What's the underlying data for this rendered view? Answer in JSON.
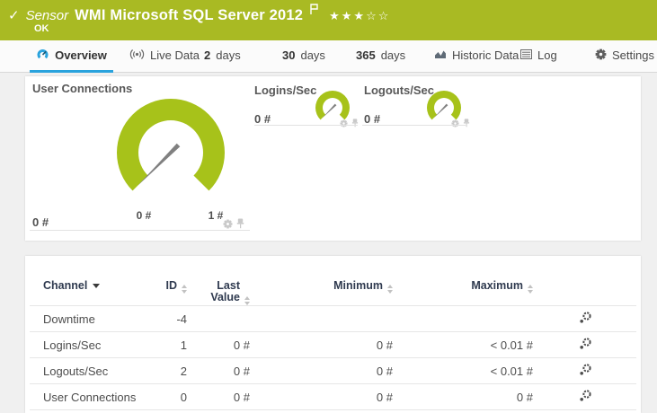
{
  "header": {
    "check_icon": "✓",
    "kind_label": "Sensor",
    "title": "WMI Microsoft SQL Server 2012",
    "rating_stars": "★★★☆☆",
    "status_text": "OK"
  },
  "tabs": [
    {
      "label": "Overview",
      "active": true
    },
    {
      "label": "Live Data"
    },
    {
      "prefix": "2",
      "label": "days"
    },
    {
      "prefix": "30",
      "label": "days"
    },
    {
      "prefix": "365",
      "label": "days"
    },
    {
      "label": "Historic Data"
    },
    {
      "label": "Log"
    },
    {
      "label": "Settings"
    }
  ],
  "gauges": {
    "main": {
      "title": "User Connections",
      "value": "0 #",
      "scale_min": "0 #",
      "scale_max": "1 #"
    },
    "small": [
      {
        "title": "Logins/Sec",
        "value": "0 #"
      },
      {
        "title": "Logouts/Sec",
        "value": "0 #"
      }
    ]
  },
  "table": {
    "columns": [
      "Channel",
      "ID",
      "Last Value",
      "Minimum",
      "Maximum"
    ],
    "rows": [
      {
        "channel": "Downtime",
        "id": "-4",
        "last": "",
        "min": "",
        "max": ""
      },
      {
        "channel": "Logins/Sec",
        "id": "1",
        "last": "0 #",
        "min": "0 #",
        "max": "< 0.01 #"
      },
      {
        "channel": "Logouts/Sec",
        "id": "2",
        "last": "0 #",
        "min": "0 #",
        "max": "< 0.01 #"
      },
      {
        "channel": "User Connections",
        "id": "0",
        "last": "0 #",
        "min": "0 #",
        "max": "0 #"
      }
    ]
  },
  "colors": {
    "header_green": "#a9ba23",
    "gauge_green": "#a7c21a",
    "accent_blue": "#2aa3dd",
    "page_bg": "#f0f0f0"
  }
}
